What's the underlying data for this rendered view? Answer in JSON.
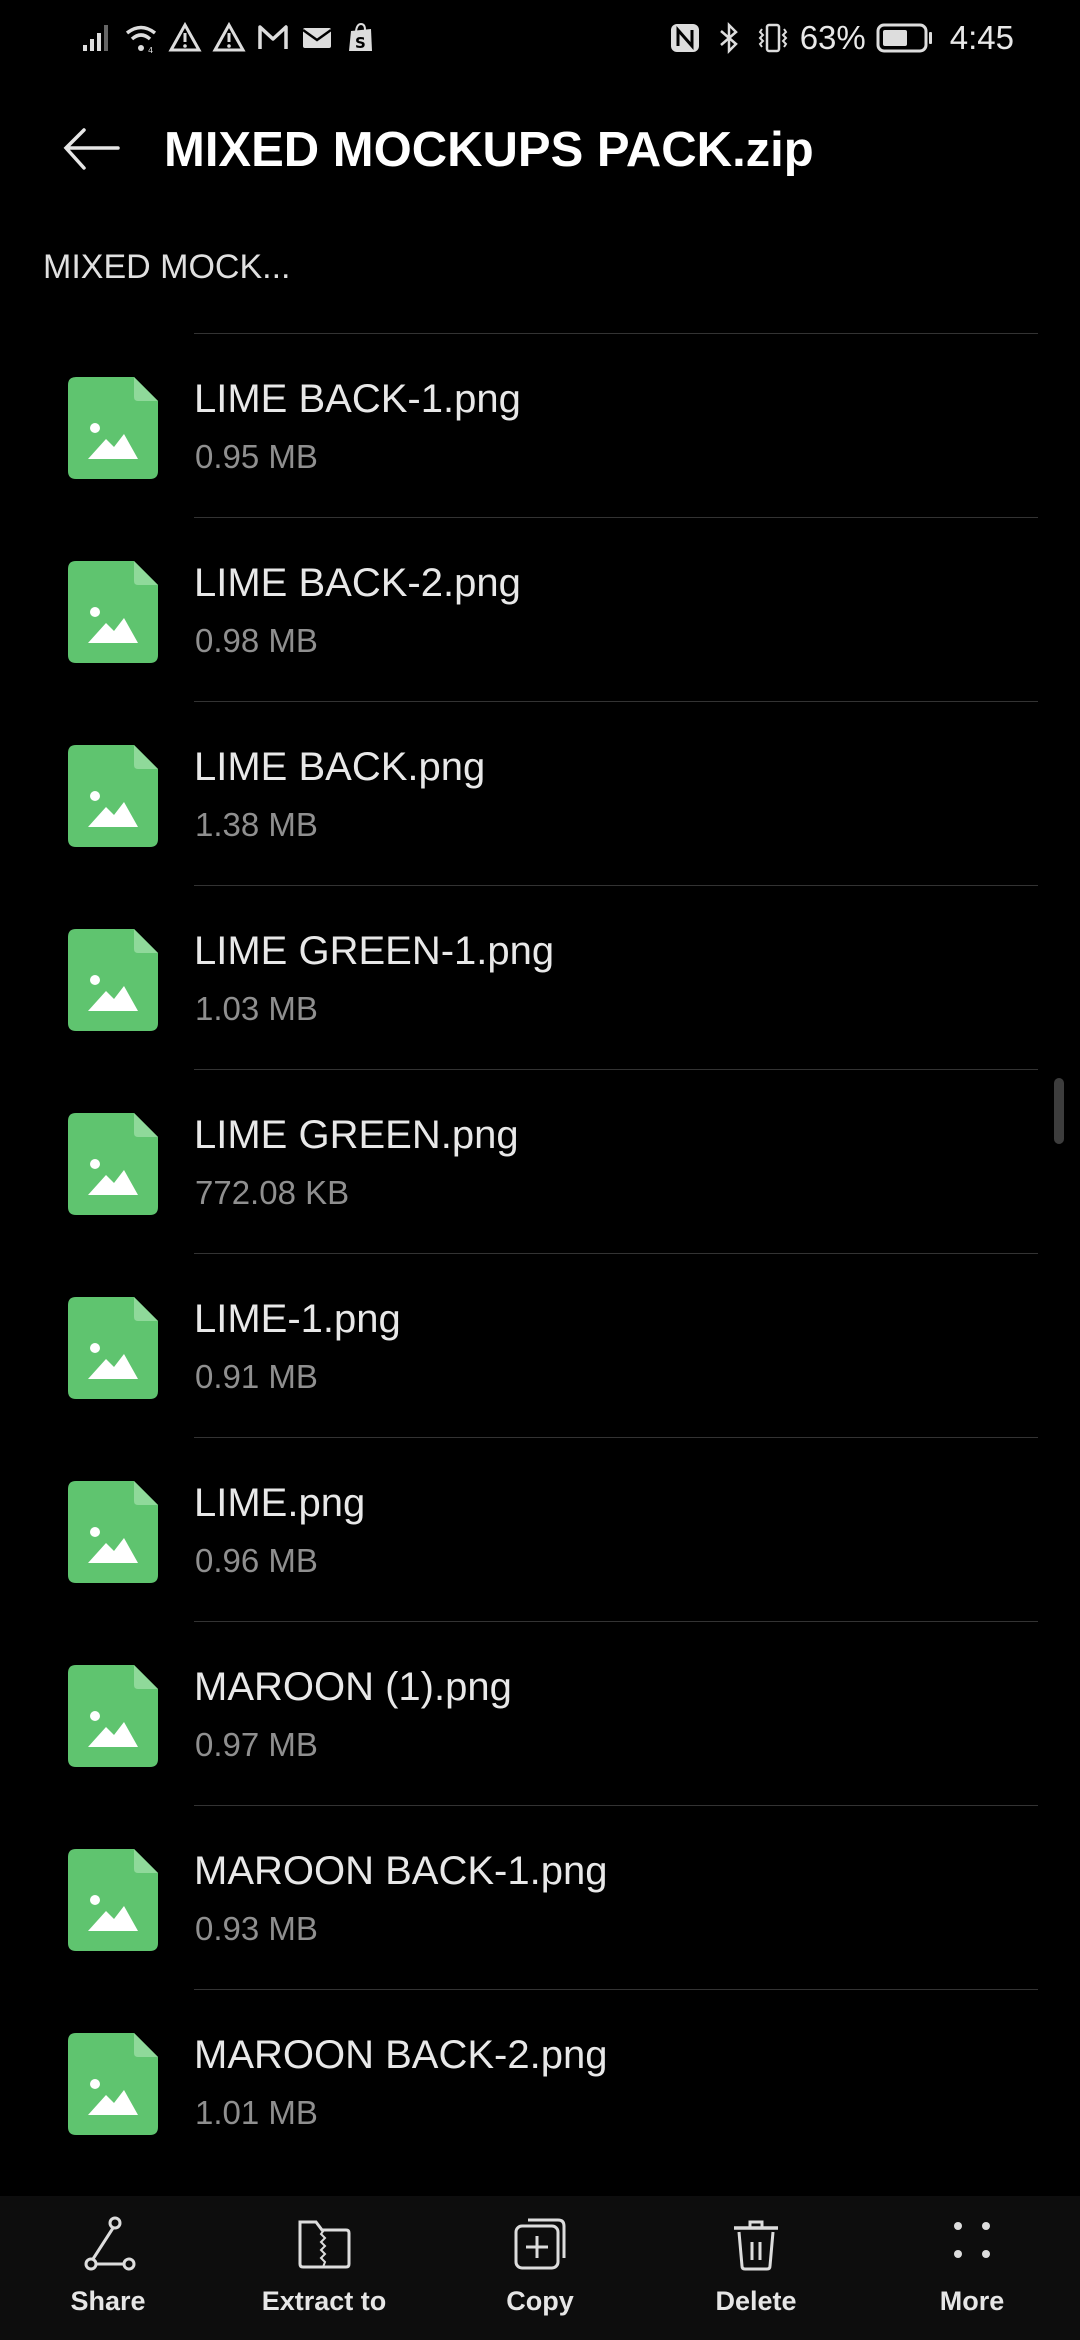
{
  "status_bar": {
    "left_icons": [
      "signal-icon",
      "wifi-icon",
      "warning-icon",
      "warning-icon",
      "gmail-icon",
      "mail-icon",
      "shopify-icon"
    ],
    "right_icons": [
      "nfc-icon",
      "bluetooth-icon",
      "vibrate-icon"
    ],
    "battery_percent": "63%",
    "battery_level": 0.63,
    "time": "4:45"
  },
  "header": {
    "back_icon": "arrow-left-icon",
    "title": "MIXED MOCKUPS PACK.zip"
  },
  "breadcrumb": {
    "label": "MIXED MOCK..."
  },
  "files": [
    {
      "name": "LIME BACK-1.png",
      "size": "0.95 MB",
      "icon": "image-file-icon"
    },
    {
      "name": "LIME BACK-2.png",
      "size": "0.98 MB",
      "icon": "image-file-icon"
    },
    {
      "name": "LIME BACK.png",
      "size": "1.38 MB",
      "icon": "image-file-icon"
    },
    {
      "name": "LIME GREEN-1.png",
      "size": "1.03 MB",
      "icon": "image-file-icon"
    },
    {
      "name": "LIME GREEN.png",
      "size": "772.08 KB",
      "icon": "image-file-icon"
    },
    {
      "name": "LIME-1.png",
      "size": "0.91 MB",
      "icon": "image-file-icon"
    },
    {
      "name": "LIME.png",
      "size": "0.96 MB",
      "icon": "image-file-icon"
    },
    {
      "name": "MAROON (1).png",
      "size": "0.97 MB",
      "icon": "image-file-icon"
    },
    {
      "name": "MAROON BACK-1.png",
      "size": "0.93 MB",
      "icon": "image-file-icon"
    },
    {
      "name": "MAROON BACK-2.png",
      "size": "1.01 MB",
      "icon": "image-file-icon"
    }
  ],
  "colors": {
    "background": "#000000",
    "file_icon": "#5fc46f",
    "file_icon_fold": "#8fd99a",
    "bottom_bar": "#0d0d0d",
    "secondary_text": "#8f8f8f"
  },
  "bottom_bar": {
    "items": [
      {
        "label": "Share",
        "icon": "share-icon"
      },
      {
        "label": "Extract to",
        "icon": "extract-folder-icon"
      },
      {
        "label": "Copy",
        "icon": "copy-icon"
      },
      {
        "label": "Delete",
        "icon": "trash-icon"
      },
      {
        "label": "More",
        "icon": "more-dots-icon"
      }
    ]
  }
}
